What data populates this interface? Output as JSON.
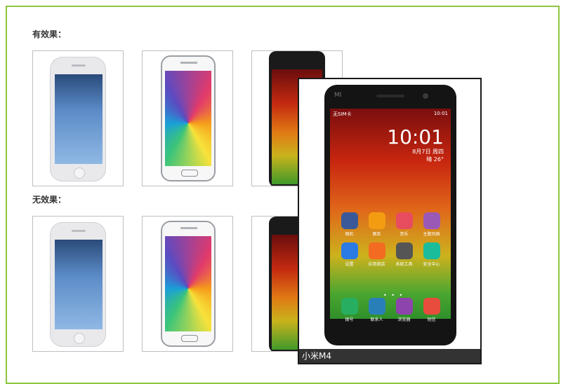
{
  "sections": {
    "effect_label": "有效果：",
    "no_effect_label": "无效果："
  },
  "popup": {
    "caption": "小米M4",
    "brand": "MI",
    "status_left": "无SIM卡",
    "status_right": "10:01",
    "clock": "10:01",
    "date": "8月7日 周四",
    "weather": "晴 26°",
    "apps": [
      {
        "name": "相机",
        "icon": "camera-icon",
        "color": "#3b5998"
      },
      {
        "name": "图库",
        "icon": "gallery-icon",
        "color": "#f39c12"
      },
      {
        "name": "音乐",
        "icon": "music-icon",
        "color": "#e84c5f"
      },
      {
        "name": "主题风格",
        "icon": "theme-icon",
        "color": "#9b59b6"
      },
      {
        "name": "设置",
        "icon": "settings-icon",
        "color": "#2c7be5"
      },
      {
        "name": "应用商店",
        "icon": "store-icon",
        "color": "#f26b21"
      },
      {
        "name": "系统工具",
        "icon": "tools-icon",
        "color": "#555555"
      },
      {
        "name": "安全中心",
        "icon": "shield-icon",
        "color": "#1abc9c"
      }
    ],
    "dock": [
      {
        "name": "拨号",
        "icon": "phone-icon",
        "color": "#27ae60"
      },
      {
        "name": "联系人",
        "icon": "contacts-icon",
        "color": "#2980b9"
      },
      {
        "name": "浏览器",
        "icon": "browser-icon",
        "color": "#8e44ad"
      },
      {
        "name": "短信",
        "icon": "sms-icon",
        "color": "#e74c3c"
      }
    ]
  }
}
